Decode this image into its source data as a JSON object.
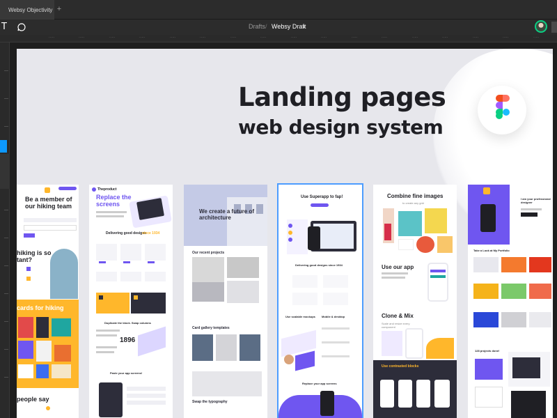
{
  "window": {
    "tab_title": "Websy Objectivity",
    "add_tab_icon": "plus-icon"
  },
  "toolbar": {
    "text_tool": "T",
    "breadcrumb_parent": "Drafts",
    "breadcrumb_separator": "/",
    "file_name": "Websy Draft",
    "file_menu_icon": "chevron-down-icon"
  },
  "canvas": {
    "hero_title": "Landing pages",
    "hero_subtitle": "web design system",
    "logo": "figma-logo"
  },
  "mockups": {
    "card1": {
      "headline": "Be a member of our hiking team",
      "fragment": "hiking is so tant?",
      "section": "cards for hiking",
      "footer": "people say"
    },
    "card2": {
      "brand": "Theproduct",
      "headline": "Replace the screens",
      "section": "Delivering good designs",
      "since": "since 1934",
      "block": "Duplicate the block. Swap columns",
      "stat": "1896",
      "footer": "Paste your app screens!"
    },
    "card3": {
      "headline": "We create a future of architecture",
      "section1": "Our recent projects",
      "section2": "Card gallery templates",
      "section3": "Swap the typography"
    },
    "card4": {
      "headline": "Use Superapp to fap!",
      "section1": "Delivering good designs since 1934",
      "section2a": "Use scalable mockups",
      "section2b": "Mobile & desktop",
      "footer": "Replace your app screens"
    },
    "card5": {
      "headline": "Combine fine images",
      "sub": "to create any grid",
      "section1": "Use our app",
      "section2": "Clone & Mix",
      "sub2": "Scale and resize every component",
      "section3": "Use contrasted blocks"
    },
    "card6": {
      "headline": "I am your professional designer",
      "section1": "Take a Look at My Portfolio",
      "footer": "128 projects done!"
    }
  },
  "colors": {
    "accent": "#0d99ff",
    "purple": "#6f56f0",
    "orange": "#ffb72b",
    "dark": "#1f1f24"
  }
}
